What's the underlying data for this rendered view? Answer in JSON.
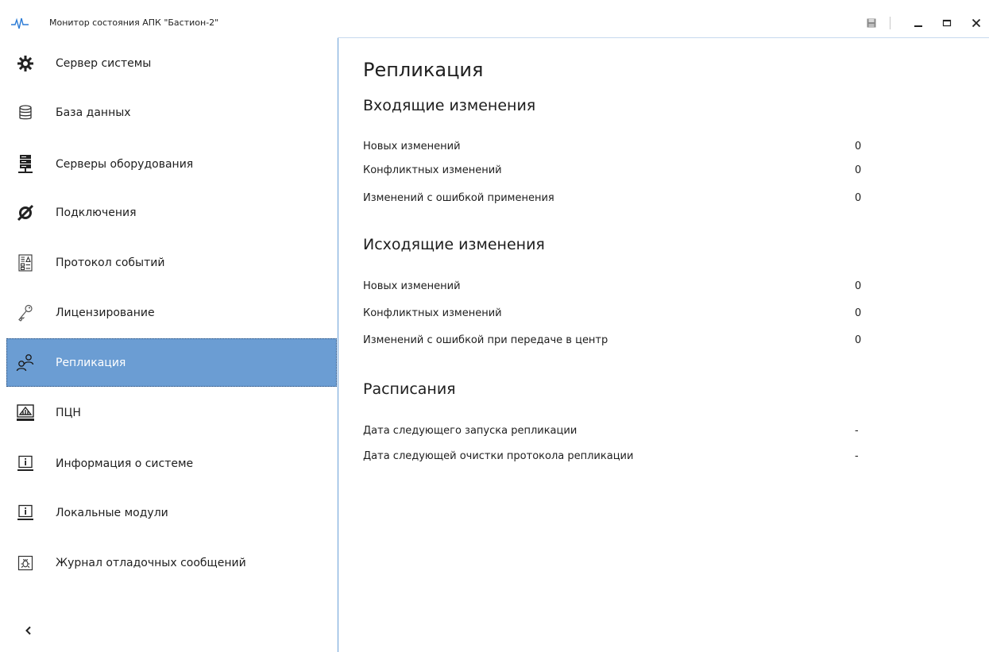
{
  "window": {
    "title": "Монитор состояния АПК \"Бастион-2\"",
    "icons": {
      "app": "pulse-icon",
      "save": "save-icon",
      "minimize": "minimize-icon",
      "maximize": "maximize-icon",
      "close": "close-icon"
    }
  },
  "sidebar": {
    "items": [
      {
        "label": "Сервер системы",
        "icon": "gear-cluster-icon"
      },
      {
        "label": "База данных",
        "icon": "database-icon"
      },
      {
        "label": "Серверы оборудования",
        "icon": "server-rack-icon"
      },
      {
        "label": "Подключения",
        "icon": "disconnect-icon"
      },
      {
        "label": "Протокол событий",
        "icon": "event-log-icon"
      },
      {
        "label": "Лицензирование",
        "icon": "key-icon"
      },
      {
        "label": "Репликация",
        "icon": "replication-users-icon",
        "active": true
      },
      {
        "label": "ПЦН",
        "icon": "monitoring-console-icon"
      },
      {
        "label": "Информация о системе",
        "icon": "info-monitor-icon"
      },
      {
        "label": "Локальные модули",
        "icon": "info-monitor-icon"
      },
      {
        "label": "Журнал отладочных сообщений",
        "icon": "debug-log-icon"
      }
    ],
    "collapse_icon": "chevron-left-icon"
  },
  "main": {
    "title": "Репликация",
    "incoming": {
      "title": "Входящие изменения",
      "rows": [
        {
          "label": "Новых изменений",
          "value": "0"
        },
        {
          "label": "Конфликтных изменений",
          "value": "0"
        },
        {
          "label": "Изменений с ошибкой применения",
          "value": "0"
        }
      ]
    },
    "outgoing": {
      "title": "Исходящие изменения",
      "rows": [
        {
          "label": "Новых изменений",
          "value": "0"
        },
        {
          "label": "Конфликтных изменений",
          "value": "0"
        },
        {
          "label": "Изменений с ошибкой при передаче в центр",
          "value": "0"
        }
      ]
    },
    "schedule": {
      "title": "Расписания",
      "rows": [
        {
          "label": "Дата следующего запуска репликации",
          "value": "-"
        },
        {
          "label": "Дата следующей очистки протокола репликации",
          "value": "-"
        }
      ]
    }
  },
  "colors": {
    "accent": "#6b9dd3",
    "divider": "#6aa0d8",
    "app_icon": "#2b7bd6"
  }
}
